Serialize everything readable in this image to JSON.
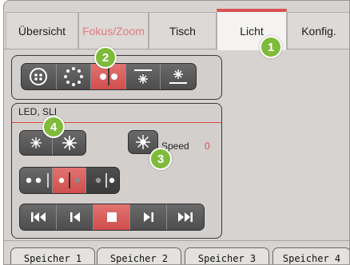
{
  "tabs": [
    {
      "label": "Übersicht",
      "state": "normal"
    },
    {
      "label": "Fokus/Zoom",
      "state": "disabled"
    },
    {
      "label": "Tisch",
      "state": "normal"
    },
    {
      "label": "Licht",
      "state": "active"
    },
    {
      "label": "Konfig.",
      "state": "normal"
    }
  ],
  "illumination_modes": [
    {
      "icon": "ring-dots-icon",
      "selected": false
    },
    {
      "icon": "segment-ring-icon",
      "selected": false
    },
    {
      "icon": "two-side-light-icon",
      "selected": true
    },
    {
      "icon": "top-light-icon",
      "selected": false
    },
    {
      "icon": "bottom-light-icon",
      "selected": false
    }
  ],
  "led_group": {
    "title": "LED, SLI",
    "brightness_buttons": [
      {
        "icon": "dim-light-icon"
      },
      {
        "icon": "bright-light-icon"
      }
    ],
    "speed_button": {
      "icon": "light-burst-icon"
    },
    "speed_label": "Speed",
    "speed_value": "0",
    "segment_buttons": [
      {
        "icon": "dots-left-icon",
        "selected": false
      },
      {
        "icon": "dots-split-active-icon",
        "selected": true
      },
      {
        "icon": "dots-right-icon",
        "selected": false
      }
    ],
    "playback_buttons": [
      {
        "icon": "skip-first-icon",
        "selected": false
      },
      {
        "icon": "step-back-icon",
        "selected": false
      },
      {
        "icon": "stop-icon",
        "selected": true
      },
      {
        "icon": "step-forward-icon",
        "selected": false
      },
      {
        "icon": "skip-last-icon",
        "selected": false
      }
    ]
  },
  "badges": [
    "1",
    "2",
    "3",
    "4"
  ],
  "memory_tabs": [
    "Speicher 1",
    "Speicher 2",
    "Speicher 3",
    "Speicher 4"
  ],
  "colors": {
    "accent": "#d9514f",
    "badge": "#7fbb3a",
    "button_dark": "#555556",
    "panel": "#d2cfcd"
  }
}
